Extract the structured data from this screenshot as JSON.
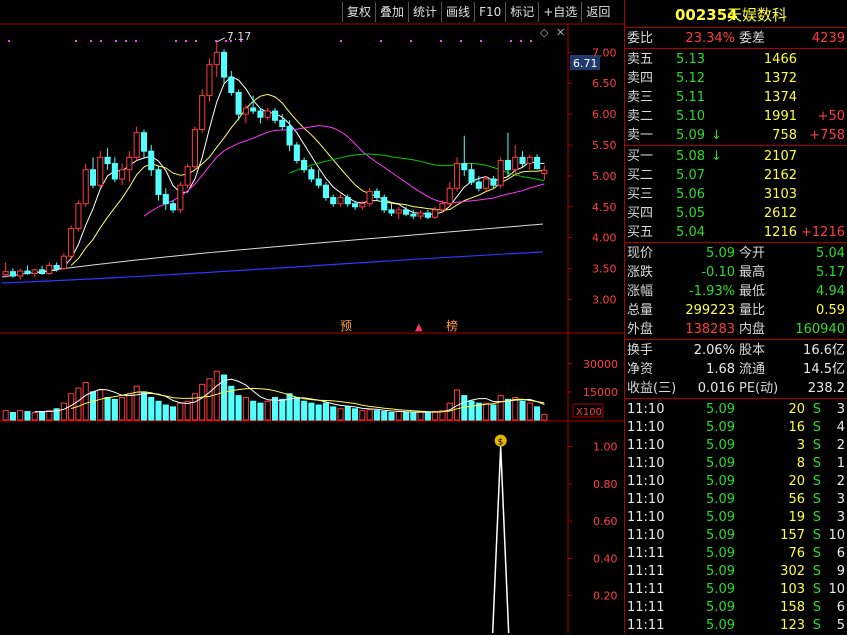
{
  "toolbar": {
    "buttons": [
      "复权",
      "叠加",
      "统计",
      "画线",
      "F10",
      "标记",
      "+自选",
      "返回"
    ]
  },
  "price_axis": {
    "labels": [
      "7.00",
      "6.50",
      "6.00",
      "5.50",
      "5.00",
      "4.50",
      "4.00",
      "3.50",
      "3.00"
    ],
    "current_tag": "6.71",
    "peak_label": "7.17"
  },
  "volume_axis": {
    "labels": [
      "30000",
      "15000"
    ],
    "unit": "X100"
  },
  "indicator_axis": {
    "labels": [
      "1.00",
      "0.80",
      "0.60",
      "0.40",
      "0.20"
    ]
  },
  "event_markers": {
    "pre": "预",
    "rank": "榜"
  },
  "header": {
    "code": "002354",
    "name": "天娱数科"
  },
  "weibi": {
    "label1": "委比",
    "value1": "23.34%",
    "label2": "委差",
    "value2": "4239"
  },
  "sells": [
    {
      "label": "卖五",
      "price": "5.13",
      "vol": "1466",
      "chg": ""
    },
    {
      "label": "卖四",
      "price": "5.12",
      "vol": "1372",
      "chg": ""
    },
    {
      "label": "卖三",
      "price": "5.11",
      "vol": "1374",
      "chg": ""
    },
    {
      "label": "卖二",
      "price": "5.10",
      "vol": "1991",
      "chg": "+50"
    },
    {
      "label": "卖一",
      "price": "5.09",
      "vol": "758",
      "chg": "+758",
      "arrow": "↓"
    }
  ],
  "buys": [
    {
      "label": "买一",
      "price": "5.08",
      "vol": "2107",
      "chg": "",
      "arrow": "↓"
    },
    {
      "label": "买二",
      "price": "5.07",
      "vol": "2162",
      "chg": ""
    },
    {
      "label": "买三",
      "price": "5.06",
      "vol": "3103",
      "chg": ""
    },
    {
      "label": "买四",
      "price": "5.05",
      "vol": "2612",
      "chg": ""
    },
    {
      "label": "买五",
      "price": "5.04",
      "vol": "1216",
      "chg": "+1216"
    }
  ],
  "stats": [
    {
      "l1": "现价",
      "v1": "5.09",
      "c1": "grn",
      "l2": "今开",
      "v2": "5.04",
      "c2": "grn"
    },
    {
      "l1": "涨跌",
      "v1": "-0.10",
      "c1": "grn",
      "l2": "最高",
      "v2": "5.17",
      "c2": "grn"
    },
    {
      "l1": "涨幅",
      "v1": "-1.93%",
      "c1": "grn",
      "l2": "最低",
      "v2": "4.94",
      "c2": "grn"
    },
    {
      "l1": "总量",
      "v1": "299223",
      "c1": "yel",
      "l2": "量比",
      "v2": "0.59",
      "c2": "yel"
    },
    {
      "l1": "外盘",
      "v1": "138283",
      "c1": "red",
      "l2": "内盘",
      "v2": "160940",
      "c2": "grn"
    }
  ],
  "stats2": [
    {
      "l1": "换手",
      "v1": "2.06%",
      "l2": "股本",
      "v2": "16.6亿"
    },
    {
      "l1": "净资",
      "v1": "1.68",
      "l2": "流通",
      "v2": "14.5亿"
    },
    {
      "l1": "收益(三)",
      "v1": "0.016",
      "l2": "PE(动)",
      "v2": "238.2"
    }
  ],
  "ticks": [
    {
      "t": "11:10",
      "p": "5.09",
      "v": "20",
      "s": "S",
      "n": "3"
    },
    {
      "t": "11:10",
      "p": "5.09",
      "v": "16",
      "s": "S",
      "n": "4"
    },
    {
      "t": "11:10",
      "p": "5.09",
      "v": "3",
      "s": "S",
      "n": "2"
    },
    {
      "t": "11:10",
      "p": "5.09",
      "v": "8",
      "s": "S",
      "n": "1"
    },
    {
      "t": "11:10",
      "p": "5.09",
      "v": "20",
      "s": "S",
      "n": "2"
    },
    {
      "t": "11:10",
      "p": "5.09",
      "v": "56",
      "s": "S",
      "n": "3"
    },
    {
      "t": "11:10",
      "p": "5.09",
      "v": "19",
      "s": "S",
      "n": "3"
    },
    {
      "t": "11:10",
      "p": "5.09",
      "v": "157",
      "s": "S",
      "n": "10"
    },
    {
      "t": "11:11",
      "p": "5.09",
      "v": "76",
      "s": "S",
      "n": "6"
    },
    {
      "t": "11:11",
      "p": "5.09",
      "v": "302",
      "s": "S",
      "n": "9"
    },
    {
      "t": "11:11",
      "p": "5.09",
      "v": "103",
      "s": "S",
      "n": "10"
    },
    {
      "t": "11:11",
      "p": "5.09",
      "v": "158",
      "s": "S",
      "n": "6"
    },
    {
      "t": "11:11",
      "p": "5.09",
      "v": "123",
      "s": "S",
      "n": "5"
    }
  ],
  "chart_data": {
    "type": "candlestick",
    "price_ylim": [
      2.7,
      7.2
    ],
    "candles": [
      {
        "o": 3.4,
        "h": 3.6,
        "l": 3.35,
        "c": 3.45
      },
      {
        "o": 3.45,
        "h": 3.5,
        "l": 3.35,
        "c": 3.38
      },
      {
        "o": 3.38,
        "h": 3.5,
        "l": 3.32,
        "c": 3.46
      },
      {
        "o": 3.46,
        "h": 3.55,
        "l": 3.4,
        "c": 3.42
      },
      {
        "o": 3.42,
        "h": 3.5,
        "l": 3.36,
        "c": 3.48
      },
      {
        "o": 3.48,
        "h": 3.55,
        "l": 3.4,
        "c": 3.42
      },
      {
        "o": 3.42,
        "h": 3.6,
        "l": 3.4,
        "c": 3.55
      },
      {
        "o": 3.55,
        "h": 3.6,
        "l": 3.45,
        "c": 3.5
      },
      {
        "o": 3.5,
        "h": 3.75,
        "l": 3.48,
        "c": 3.7
      },
      {
        "o": 3.7,
        "h": 4.2,
        "l": 3.65,
        "c": 4.15
      },
      {
        "o": 4.15,
        "h": 4.6,
        "l": 4.1,
        "c": 4.55
      },
      {
        "o": 4.55,
        "h": 5.2,
        "l": 4.5,
        "c": 5.1
      },
      {
        "o": 5.1,
        "h": 5.3,
        "l": 4.8,
        "c": 4.85
      },
      {
        "o": 4.85,
        "h": 5.4,
        "l": 4.8,
        "c": 5.3
      },
      {
        "o": 5.3,
        "h": 5.45,
        "l": 5.1,
        "c": 5.2
      },
      {
        "o": 5.2,
        "h": 5.3,
        "l": 4.9,
        "c": 4.95
      },
      {
        "o": 4.95,
        "h": 5.2,
        "l": 4.85,
        "c": 5.1
      },
      {
        "o": 5.1,
        "h": 5.4,
        "l": 4.9,
        "c": 5.3
      },
      {
        "o": 5.3,
        "h": 5.8,
        "l": 5.25,
        "c": 5.7
      },
      {
        "o": 5.7,
        "h": 5.75,
        "l": 5.3,
        "c": 5.4
      },
      {
        "o": 5.4,
        "h": 5.5,
        "l": 5.0,
        "c": 5.1
      },
      {
        "o": 5.1,
        "h": 5.15,
        "l": 4.6,
        "c": 4.7
      },
      {
        "o": 4.7,
        "h": 4.8,
        "l": 4.45,
        "c": 4.55
      },
      {
        "o": 4.55,
        "h": 4.6,
        "l": 4.4,
        "c": 4.45
      },
      {
        "o": 4.45,
        "h": 4.9,
        "l": 4.4,
        "c": 4.85
      },
      {
        "o": 4.85,
        "h": 5.2,
        "l": 4.8,
        "c": 5.15
      },
      {
        "o": 5.15,
        "h": 5.8,
        "l": 5.1,
        "c": 5.75
      },
      {
        "o": 5.75,
        "h": 6.4,
        "l": 5.7,
        "c": 6.3
      },
      {
        "o": 6.3,
        "h": 6.9,
        "l": 6.2,
        "c": 6.8
      },
      {
        "o": 6.8,
        "h": 7.17,
        "l": 6.6,
        "c": 7.0
      },
      {
        "o": 7.0,
        "h": 7.05,
        "l": 6.5,
        "c": 6.6
      },
      {
        "o": 6.6,
        "h": 6.7,
        "l": 6.3,
        "c": 6.35
      },
      {
        "o": 6.35,
        "h": 6.4,
        "l": 5.9,
        "c": 6.0
      },
      {
        "o": 6.0,
        "h": 6.15,
        "l": 5.85,
        "c": 6.1
      },
      {
        "o": 6.1,
        "h": 6.3,
        "l": 6.0,
        "c": 6.05
      },
      {
        "o": 6.05,
        "h": 6.1,
        "l": 5.85,
        "c": 5.95
      },
      {
        "o": 5.95,
        "h": 6.1,
        "l": 5.9,
        "c": 6.05
      },
      {
        "o": 6.05,
        "h": 6.1,
        "l": 5.85,
        "c": 5.9
      },
      {
        "o": 5.9,
        "h": 6.0,
        "l": 5.75,
        "c": 5.8
      },
      {
        "o": 5.8,
        "h": 5.9,
        "l": 5.4,
        "c": 5.5
      },
      {
        "o": 5.5,
        "h": 5.55,
        "l": 5.2,
        "c": 5.25
      },
      {
        "o": 5.25,
        "h": 5.3,
        "l": 5.05,
        "c": 5.1
      },
      {
        "o": 5.1,
        "h": 5.15,
        "l": 4.9,
        "c": 4.95
      },
      {
        "o": 4.95,
        "h": 5.1,
        "l": 4.8,
        "c": 4.85
      },
      {
        "o": 4.85,
        "h": 4.9,
        "l": 4.6,
        "c": 4.65
      },
      {
        "o": 4.65,
        "h": 4.7,
        "l": 4.5,
        "c": 4.55
      },
      {
        "o": 4.55,
        "h": 4.7,
        "l": 4.5,
        "c": 4.65
      },
      {
        "o": 4.65,
        "h": 4.7,
        "l": 4.5,
        "c": 4.55
      },
      {
        "o": 4.55,
        "h": 4.6,
        "l": 4.45,
        "c": 4.5
      },
      {
        "o": 4.5,
        "h": 4.6,
        "l": 4.45,
        "c": 4.55
      },
      {
        "o": 4.55,
        "h": 4.8,
        "l": 4.5,
        "c": 4.75
      },
      {
        "o": 4.75,
        "h": 4.8,
        "l": 4.6,
        "c": 4.65
      },
      {
        "o": 4.65,
        "h": 4.7,
        "l": 4.4,
        "c": 4.45
      },
      {
        "o": 4.45,
        "h": 4.55,
        "l": 4.35,
        "c": 4.4
      },
      {
        "o": 4.4,
        "h": 4.5,
        "l": 4.3,
        "c": 4.45
      },
      {
        "o": 4.45,
        "h": 4.5,
        "l": 4.35,
        "c": 4.38
      },
      {
        "o": 4.38,
        "h": 4.45,
        "l": 4.3,
        "c": 4.35
      },
      {
        "o": 4.35,
        "h": 4.45,
        "l": 4.3,
        "c": 4.4
      },
      {
        "o": 4.4,
        "h": 4.45,
        "l": 4.3,
        "c": 4.33
      },
      {
        "o": 4.33,
        "h": 4.5,
        "l": 4.3,
        "c": 4.45
      },
      {
        "o": 4.45,
        "h": 4.6,
        "l": 4.4,
        "c": 4.55
      },
      {
        "o": 4.55,
        "h": 4.9,
        "l": 4.5,
        "c": 4.8
      },
      {
        "o": 4.8,
        "h": 5.3,
        "l": 4.75,
        "c": 5.2
      },
      {
        "o": 5.2,
        "h": 5.65,
        "l": 5.0,
        "c": 5.1
      },
      {
        "o": 5.1,
        "h": 5.2,
        "l": 4.85,
        "c": 4.9
      },
      {
        "o": 4.9,
        "h": 5.0,
        "l": 4.75,
        "c": 4.8
      },
      {
        "o": 4.8,
        "h": 5.0,
        "l": 4.75,
        "c": 4.95
      },
      {
        "o": 4.95,
        "h": 5.0,
        "l": 4.8,
        "c": 4.85
      },
      {
        "o": 4.85,
        "h": 5.3,
        "l": 4.8,
        "c": 5.25
      },
      {
        "o": 5.25,
        "h": 5.7,
        "l": 5.0,
        "c": 5.1
      },
      {
        "o": 5.1,
        "h": 5.5,
        "l": 5.0,
        "c": 5.3
      },
      {
        "o": 5.3,
        "h": 5.4,
        "l": 5.15,
        "c": 5.2
      },
      {
        "o": 5.2,
        "h": 5.35,
        "l": 5.1,
        "c": 5.3
      },
      {
        "o": 5.3,
        "h": 5.35,
        "l": 5.1,
        "c": 5.12
      },
      {
        "o": 5.04,
        "h": 5.17,
        "l": 4.94,
        "c": 5.09
      }
    ],
    "volume_ylim": [
      0,
      40000
    ],
    "volumes": [
      5000,
      4000,
      5000,
      4500,
      4000,
      4500,
      5000,
      6000,
      9000,
      14000,
      17000,
      20000,
      15000,
      16000,
      12000,
      11000,
      12000,
      14000,
      18000,
      15000,
      12000,
      10000,
      8000,
      7000,
      9000,
      10000,
      14000,
      19000,
      22000,
      26000,
      24000,
      18000,
      13000,
      12000,
      10000,
      9000,
      10000,
      12000,
      11000,
      14000,
      12000,
      10000,
      9000,
      8000,
      9000,
      7000,
      6000,
      7000,
      6000,
      5000,
      5500,
      5000,
      4500,
      4000,
      4500,
      4000,
      4000,
      4500,
      4000,
      4500,
      5000,
      9000,
      16000,
      13000,
      10000,
      9000,
      9000,
      8000,
      13000,
      11000,
      12000,
      10000,
      9000,
      7000,
      3000
    ],
    "indicator_ylim": [
      0,
      1.1
    ],
    "indicator": {
      "spike_index": 68,
      "spike_value": 1.0
    }
  }
}
